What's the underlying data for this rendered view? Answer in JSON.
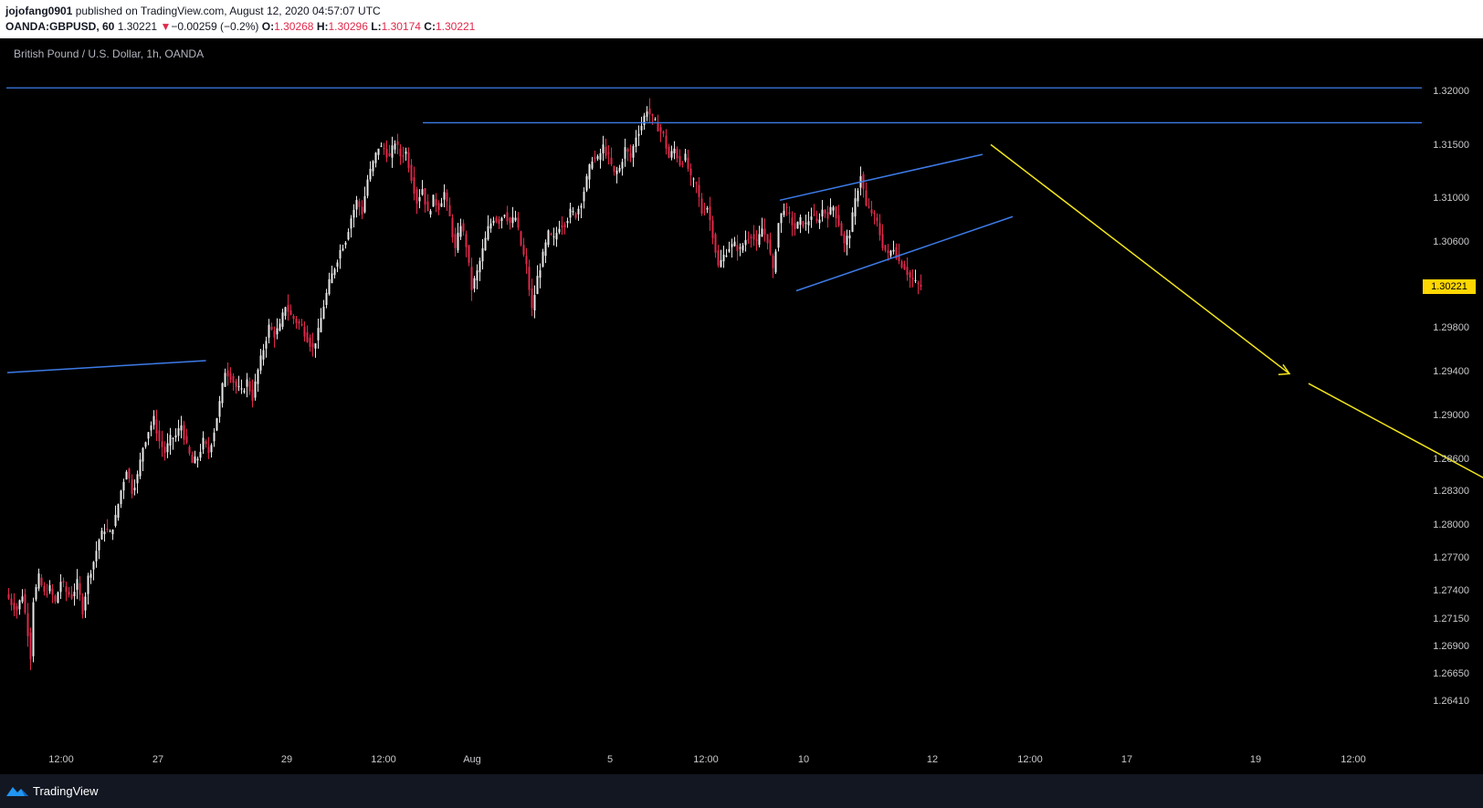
{
  "header": {
    "author": "jojofang0901",
    "published_text": "published on TradingView.com, August 12, 2020 04:57:07 UTC",
    "symbol": "OANDA:GBPUSD, 60",
    "last_price": "1.30221",
    "change_arrow": "▼",
    "change": "−0.00259 (−0.2%)",
    "open_label": "O:",
    "open": "1.30268",
    "high_label": "H:",
    "high": "1.30296",
    "low_label": "L:",
    "low": "1.30174",
    "close_label": "C:",
    "close": "1.30221"
  },
  "chart_title": "British Pound / U.S. Dollar, 1h, OANDA",
  "colors": {
    "bull": "#e8e8e8",
    "bear": "#e0294a",
    "trendline": "#3d7be8",
    "projection": "#f2e51a",
    "price_tag": "#ffd700"
  },
  "chart_data": {
    "type": "candlestick",
    "title": "British Pound / U.S. Dollar, 1h, OANDA",
    "y_axis_labels": [
      "1.32000",
      "1.31500",
      "1.31000",
      "1.30600",
      "1.29800",
      "1.29400",
      "1.29000",
      "1.28600",
      "1.28300",
      "1.28000",
      "1.27700",
      "1.27400",
      "1.27150",
      "1.26900",
      "1.26650",
      "1.26410"
    ],
    "x_axis_labels": [
      "12:00",
      "27",
      "29",
      "12:00",
      "Aug",
      "5",
      "12:00",
      "10",
      "12",
      "12:00",
      "17",
      "19",
      "12:00"
    ],
    "current_price": "1.30221",
    "ohlc_path": [
      [
        0,
        1.274
      ],
      [
        4,
        1.2732
      ],
      [
        8,
        1.2726
      ],
      [
        12,
        1.274
      ],
      [
        16,
        1.2705
      ],
      [
        18,
        1.2683
      ],
      [
        20,
        1.2735
      ],
      [
        24,
        1.2755
      ],
      [
        28,
        1.274
      ],
      [
        32,
        1.2745
      ],
      [
        36,
        1.2732
      ],
      [
        40,
        1.2752
      ],
      [
        44,
        1.2742
      ],
      [
        48,
        1.2738
      ],
      [
        52,
        1.275
      ],
      [
        56,
        1.2725
      ],
      [
        60,
        1.2755
      ],
      [
        64,
        1.277
      ],
      [
        68,
        1.279
      ],
      [
        72,
        1.28
      ],
      [
        76,
        1.2795
      ],
      [
        80,
        1.281
      ],
      [
        84,
        1.2835
      ],
      [
        88,
        1.2855
      ],
      [
        92,
        1.2835
      ],
      [
        96,
        1.2848
      ],
      [
        100,
        1.2875
      ],
      [
        104,
        1.289
      ],
      [
        108,
        1.29
      ],
      [
        112,
        1.288
      ],
      [
        116,
        1.287
      ],
      [
        120,
        1.2882
      ],
      [
        124,
        1.2885
      ],
      [
        128,
        1.2895
      ],
      [
        132,
        1.2875
      ],
      [
        136,
        1.286
      ],
      [
        140,
        1.2865
      ],
      [
        144,
        1.288
      ],
      [
        148,
        1.287
      ],
      [
        152,
        1.289
      ],
      [
        156,
        1.2915
      ],
      [
        160,
        1.2945
      ],
      [
        164,
        1.294
      ],
      [
        168,
        1.293
      ],
      [
        172,
        1.2925
      ],
      [
        176,
        1.2935
      ],
      [
        180,
        1.292
      ],
      [
        184,
        1.2945
      ],
      [
        188,
        1.2965
      ],
      [
        192,
        1.2985
      ],
      [
        196,
        1.2978
      ],
      [
        200,
        1.2985
      ],
      [
        204,
        1.3005
      ],
      [
        208,
        1.2995
      ],
      [
        212,
        1.299
      ],
      [
        216,
        1.2985
      ],
      [
        220,
        1.2975
      ],
      [
        224,
        1.2965
      ],
      [
        228,
        1.298
      ],
      [
        232,
        1.3005
      ],
      [
        236,
        1.3025
      ],
      [
        240,
        1.304
      ],
      [
        244,
        1.3055
      ],
      [
        248,
        1.3065
      ],
      [
        252,
        1.3085
      ],
      [
        256,
        1.31
      ],
      [
        260,
        1.309
      ],
      [
        264,
        1.312
      ],
      [
        268,
        1.3135
      ],
      [
        272,
        1.315
      ],
      [
        276,
        1.3148
      ],
      [
        280,
        1.314
      ],
      [
        284,
        1.3155
      ],
      [
        288,
        1.3142
      ],
      [
        292,
        1.3145
      ],
      [
        296,
        1.3122
      ],
      [
        300,
        1.31
      ],
      [
        304,
        1.3112
      ],
      [
        308,
        1.3088
      ],
      [
        312,
        1.3102
      ],
      [
        316,
        1.3095
      ],
      [
        320,
        1.3108
      ],
      [
        324,
        1.3085
      ],
      [
        328,
        1.3055
      ],
      [
        332,
        1.308
      ],
      [
        336,
        1.306
      ],
      [
        340,
        1.302
      ],
      [
        344,
        1.3035
      ],
      [
        348,
        1.3055
      ],
      [
        352,
        1.3075
      ],
      [
        356,
        1.3085
      ],
      [
        360,
        1.3082
      ],
      [
        364,
        1.309
      ],
      [
        368,
        1.308
      ],
      [
        372,
        1.3085
      ],
      [
        376,
        1.306
      ],
      [
        380,
        1.304
      ],
      [
        384,
        1.3
      ],
      [
        388,
        1.303
      ],
      [
        392,
        1.305
      ],
      [
        396,
        1.307
      ],
      [
        400,
        1.3065
      ],
      [
        404,
        1.3078
      ],
      [
        408,
        1.308
      ],
      [
        412,
        1.309
      ],
      [
        416,
        1.3088
      ],
      [
        420,
        1.31
      ],
      [
        424,
        1.312
      ],
      [
        428,
        1.314
      ],
      [
        432,
        1.3138
      ],
      [
        436,
        1.315
      ],
      [
        440,
        1.314
      ],
      [
        444,
        1.3125
      ],
      [
        448,
        1.313
      ],
      [
        452,
        1.3148
      ],
      [
        456,
        1.314
      ],
      [
        460,
        1.316
      ],
      [
        464,
        1.317
      ],
      [
        468,
        1.3185
      ],
      [
        472,
        1.3175
      ],
      [
        476,
        1.3168
      ],
      [
        480,
        1.316
      ],
      [
        484,
        1.314
      ],
      [
        488,
        1.3148
      ],
      [
        492,
        1.3135
      ],
      [
        496,
        1.314
      ],
      [
        500,
        1.312
      ],
      [
        504,
        1.3115
      ],
      [
        508,
        1.309
      ],
      [
        512,
        1.3095
      ],
      [
        516,
        1.307
      ],
      [
        520,
        1.304
      ],
      [
        524,
        1.305
      ],
      [
        528,
        1.3058
      ],
      [
        532,
        1.306
      ],
      [
        536,
        1.3055
      ],
      [
        540,
        1.3065
      ],
      [
        544,
        1.307
      ],
      [
        548,
        1.306
      ],
      [
        552,
        1.3075
      ],
      [
        556,
        1.3065
      ],
      [
        560,
        1.3035
      ],
      [
        564,
        1.308
      ],
      [
        568,
        1.3095
      ],
      [
        572,
        1.3085
      ],
      [
        576,
        1.3075
      ],
      [
        580,
        1.3082
      ],
      [
        584,
        1.3078
      ],
      [
        588,
        1.3088
      ],
      [
        592,
        1.308
      ],
      [
        596,
        1.3092
      ],
      [
        600,
        1.3088
      ],
      [
        604,
        1.3095
      ],
      [
        608,
        1.308
      ],
      [
        612,
        1.306
      ],
      [
        616,
        1.3072
      ],
      [
        620,
        1.31
      ],
      [
        624,
        1.3125
      ],
      [
        628,
        1.3095
      ],
      [
        632,
        1.309
      ],
      [
        636,
        1.308
      ],
      [
        640,
        1.306
      ],
      [
        644,
        1.305
      ],
      [
        648,
        1.3058
      ],
      [
        652,
        1.3045
      ],
      [
        656,
        1.304
      ],
      [
        660,
        1.303
      ],
      [
        664,
        1.3025
      ],
      [
        668,
        1.3022
      ]
    ],
    "annotations": [
      {
        "type": "horizontal_line",
        "price": 1.3204
      },
      {
        "type": "horizontal_line",
        "price": 1.3172
      },
      {
        "type": "trendline",
        "from": [
          0,
          1.2943
        ],
        "to": [
          145,
          1.2954
        ]
      },
      {
        "type": "channel_upper",
        "from": [
          564,
          1.3101
        ],
        "to": [
          712,
          1.3143
        ]
      },
      {
        "type": "channel_lower",
        "from": [
          576,
          1.3018
        ],
        "to": [
          734,
          1.3086
        ]
      },
      {
        "type": "projection_arrow",
        "from": [
          718,
          1.3152
        ],
        "to": [
          936,
          1.2942
        ]
      },
      {
        "type": "projection_line",
        "from": [
          950,
          1.2933
        ],
        "to": [
          1210,
          1.2757
        ]
      }
    ]
  }
}
